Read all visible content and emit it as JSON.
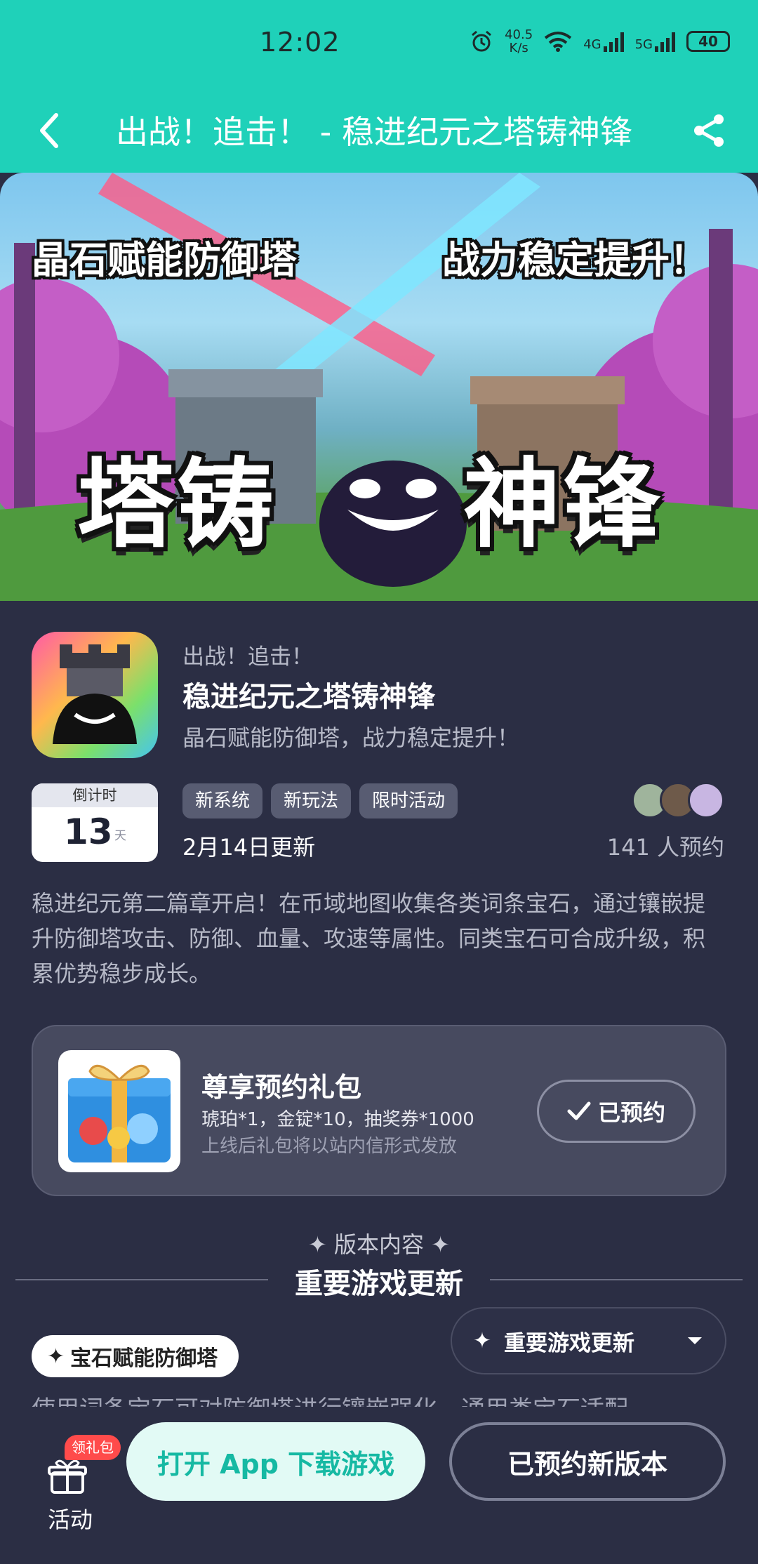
{
  "status_bar": {
    "time": "12:02",
    "net_speed_value": "40.5",
    "net_speed_unit": "K/s",
    "signal1": "4G",
    "signal2": "5G",
    "battery": "40"
  },
  "nav": {
    "title": "出战！追击！ - 稳进纪元之塔铸神锋",
    "back_icon": "chevron-left-icon",
    "share_icon": "share-icon"
  },
  "banner": {
    "caption_left": "晶石赋能防御塔",
    "caption_right": "战力稳定提升！",
    "logo_left": "塔铸",
    "logo_right": "神锋"
  },
  "game": {
    "subtitle": "出战！追击！",
    "title": "稳进纪元之塔铸神锋",
    "slogan": "晶石赋能防御塔，战力稳定提升！",
    "countdown_label": "倒计时",
    "countdown_value": "13",
    "countdown_unit": "天",
    "tags": [
      "新系统",
      "新玩法",
      "限时活动"
    ],
    "update_date": "2月14日更新",
    "reserve_count": "141 人预约",
    "description": "稳进纪元第二篇章开启！在币域地图收集各类词条宝石，通过镶嵌提升防御塔攻击、防御、血量、攻速等属性。同类宝石可合成升级，积累优势稳步成长。"
  },
  "gift": {
    "title": "尊享预约礼包",
    "items": "琥珀*1，金锭*10，抽奖券*1000",
    "note": "上线后礼包将以站内信形式发放",
    "button_label": "已预约"
  },
  "version": {
    "label": "✦ 版本内容 ✦",
    "section_title": "重要游戏更新",
    "feature_tag": "宝石赋能防御塔",
    "dropdown_label": "重要游戏更新",
    "cut_text": "使用词条宝石可对防御塔进行镶嵌强化，通用类宝石适配"
  },
  "bottom": {
    "badge": "领礼包",
    "activity_label": "活动",
    "open_app_label": "打开 App 下载游戏",
    "reserved_version_label": "已预约新版本"
  },
  "colors": {
    "accent": "#1fd1b9",
    "background": "#2b2e44",
    "card": "#474a5f",
    "badge": "#ff4b4b"
  }
}
